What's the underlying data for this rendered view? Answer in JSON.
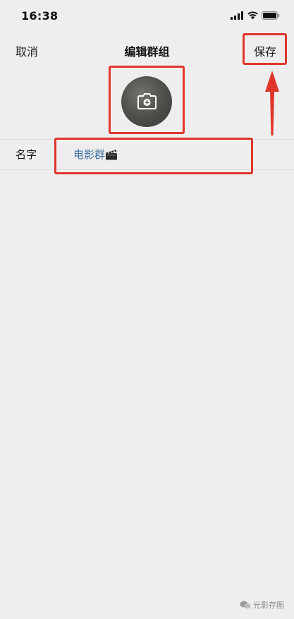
{
  "status_bar": {
    "time": "16:38"
  },
  "nav": {
    "cancel_label": "取消",
    "title": "编辑群组",
    "save_label": "保存"
  },
  "group": {
    "name_label": "名字",
    "name_value": "电影群"
  },
  "watermark": {
    "text": "光影存图"
  },
  "colors": {
    "background": "#efeeef",
    "name_value": "#3d6f9e",
    "annotation": "#e0352b"
  },
  "icons": {
    "avatar_overlay": "camera-icon",
    "name_suffix": "clapperboard-icon"
  }
}
